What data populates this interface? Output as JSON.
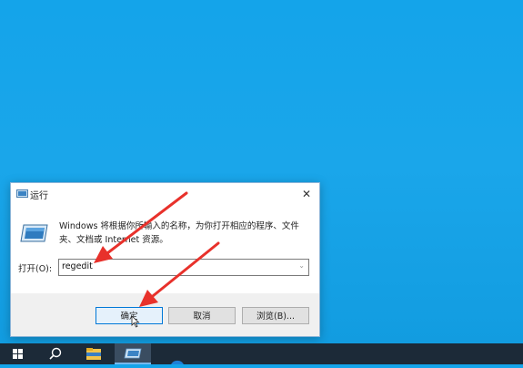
{
  "dialog": {
    "title": "运行",
    "description": "Windows 将根据你所输入的名称，为你打开相应的程序、文件夹、文档或 Internet 资源。",
    "open_label": "打开(O):",
    "input_value": "regedit",
    "buttons": {
      "ok": "确定",
      "cancel": "取消",
      "browse": "浏览(B)..."
    }
  },
  "taskbar": {
    "items": [
      "start-icon",
      "search-icon",
      "file-explorer-icon",
      "run-icon",
      "edge-icon"
    ]
  },
  "colors": {
    "desktop": "#14a4ea",
    "taskbar": "#1c2a38",
    "arrow": "#e8312b",
    "accent": "#0078d7"
  }
}
